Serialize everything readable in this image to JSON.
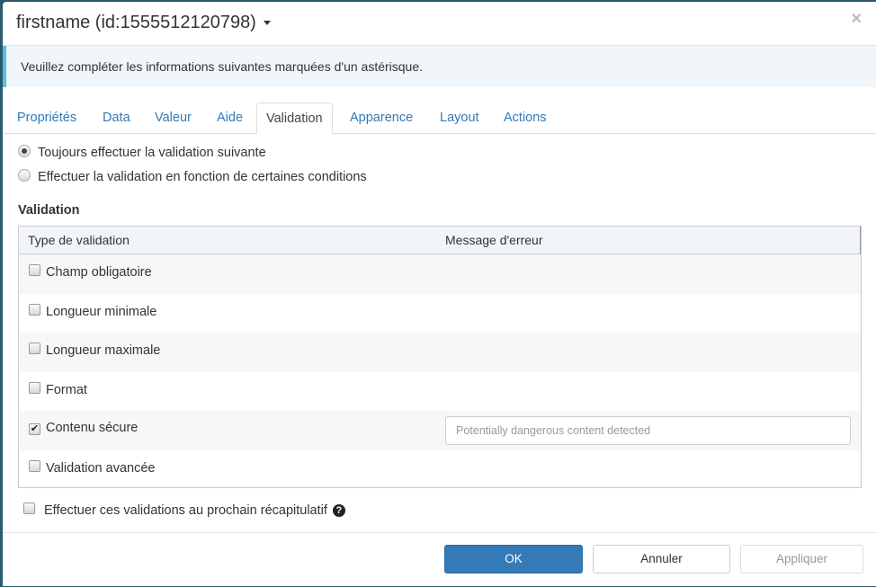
{
  "header": {
    "title": "firstname (id:1555512120798)",
    "close_label": "×"
  },
  "alert": {
    "text": "Veuillez compléter les informations suivantes marquées d'un astérisque."
  },
  "tabs": [
    {
      "label": "Propriétés",
      "active": false
    },
    {
      "label": "Data",
      "active": false
    },
    {
      "label": "Valeur",
      "active": false
    },
    {
      "label": "Aide",
      "active": false
    },
    {
      "label": "Validation",
      "active": true
    },
    {
      "label": "Apparence",
      "active": false
    },
    {
      "label": "Layout",
      "active": false
    },
    {
      "label": "Actions",
      "active": false
    }
  ],
  "validation_mode": {
    "options": [
      {
        "label": "Toujours effectuer la validation suivante",
        "checked": true
      },
      {
        "label": "Effectuer la validation en fonction de certaines conditions",
        "checked": false
      }
    ]
  },
  "validation_section": {
    "label": "Validation",
    "columns": [
      "Type de validation",
      "Message d'erreur"
    ],
    "rows": [
      {
        "label": "Champ obligatoire",
        "checked": false,
        "message": null
      },
      {
        "label": "Longueur minimale",
        "checked": false,
        "message": null
      },
      {
        "label": "Longueur maximale",
        "checked": false,
        "message": null
      },
      {
        "label": "Format",
        "checked": false,
        "message": null
      },
      {
        "label": "Contenu sécure",
        "checked": true,
        "message_placeholder": "Potentially dangerous content detected"
      },
      {
        "label": "Validation avancée",
        "checked": false,
        "message": null
      }
    ]
  },
  "summary_check": {
    "label": "Effectuer ces validations au prochain récapitulatif",
    "checked": false,
    "help_icon": "question-circle-icon",
    "help_glyph": "?"
  },
  "footer": {
    "ok_label": "OK",
    "cancel_label": "Annuler",
    "apply_label": "Appliquer"
  },
  "colors": {
    "primary": "#337ab7",
    "info_border": "#5bc0de",
    "link": "#337ab7"
  }
}
